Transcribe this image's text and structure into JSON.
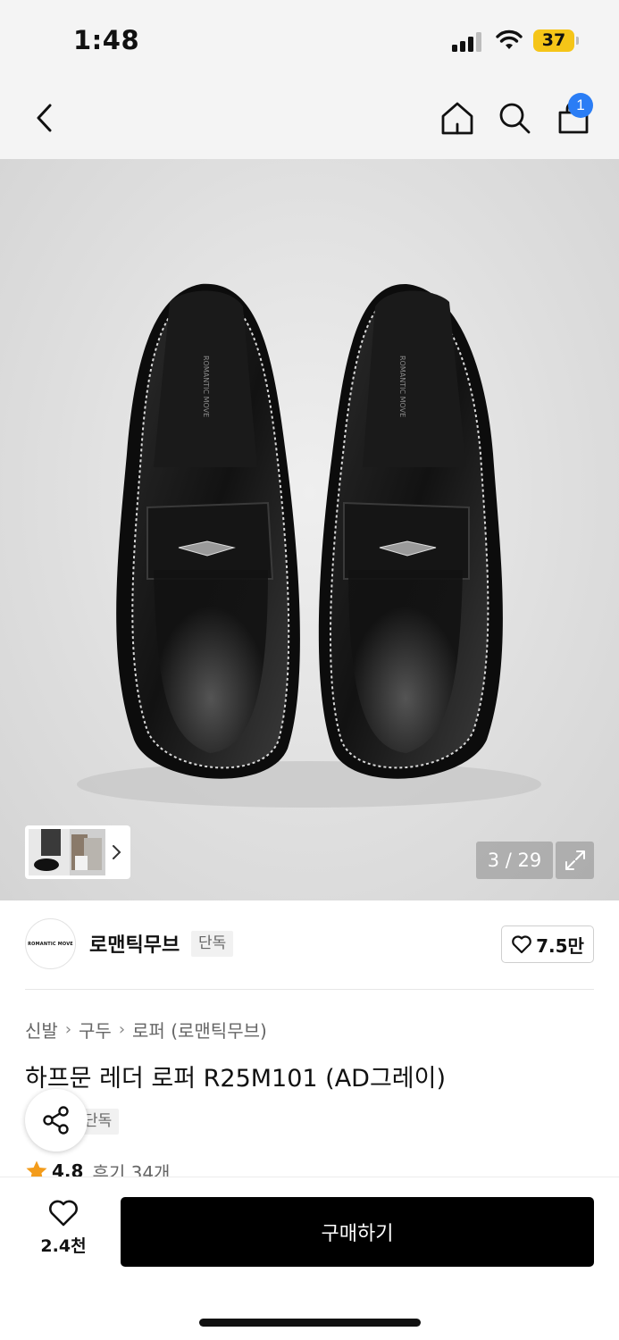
{
  "status_bar": {
    "time": "1:48",
    "battery": "37"
  },
  "nav": {
    "icons": [
      "back-icon",
      "home-icon",
      "search-icon",
      "cart-icon"
    ],
    "cart_badge": "1"
  },
  "gallery": {
    "page_indicator": "3 / 29",
    "shoe_brand_print": "ROMANTIC MOVE"
  },
  "brand": {
    "logo_text": "ROMANTIC MOVE",
    "name": "로맨틱무브",
    "exclusive_tag": "단독",
    "like_count": "7.5만"
  },
  "breadcrumb": {
    "items": [
      "신발",
      "구두",
      "로퍼 (로맨틱무브)"
    ]
  },
  "product": {
    "title": "하프문 레더 로퍼 R25M101 (AD그레이)",
    "exclusive_tag": "단독",
    "rating": "4.8",
    "review_label": "후기 34개"
  },
  "bottom_bar": {
    "wish_count": "2.4천",
    "buy_label": "구매하기"
  },
  "colors": {
    "accent_badge": "#2a7df5",
    "battery": "#f5c518",
    "star": "#f39c1b",
    "buy_button": "#000000"
  }
}
